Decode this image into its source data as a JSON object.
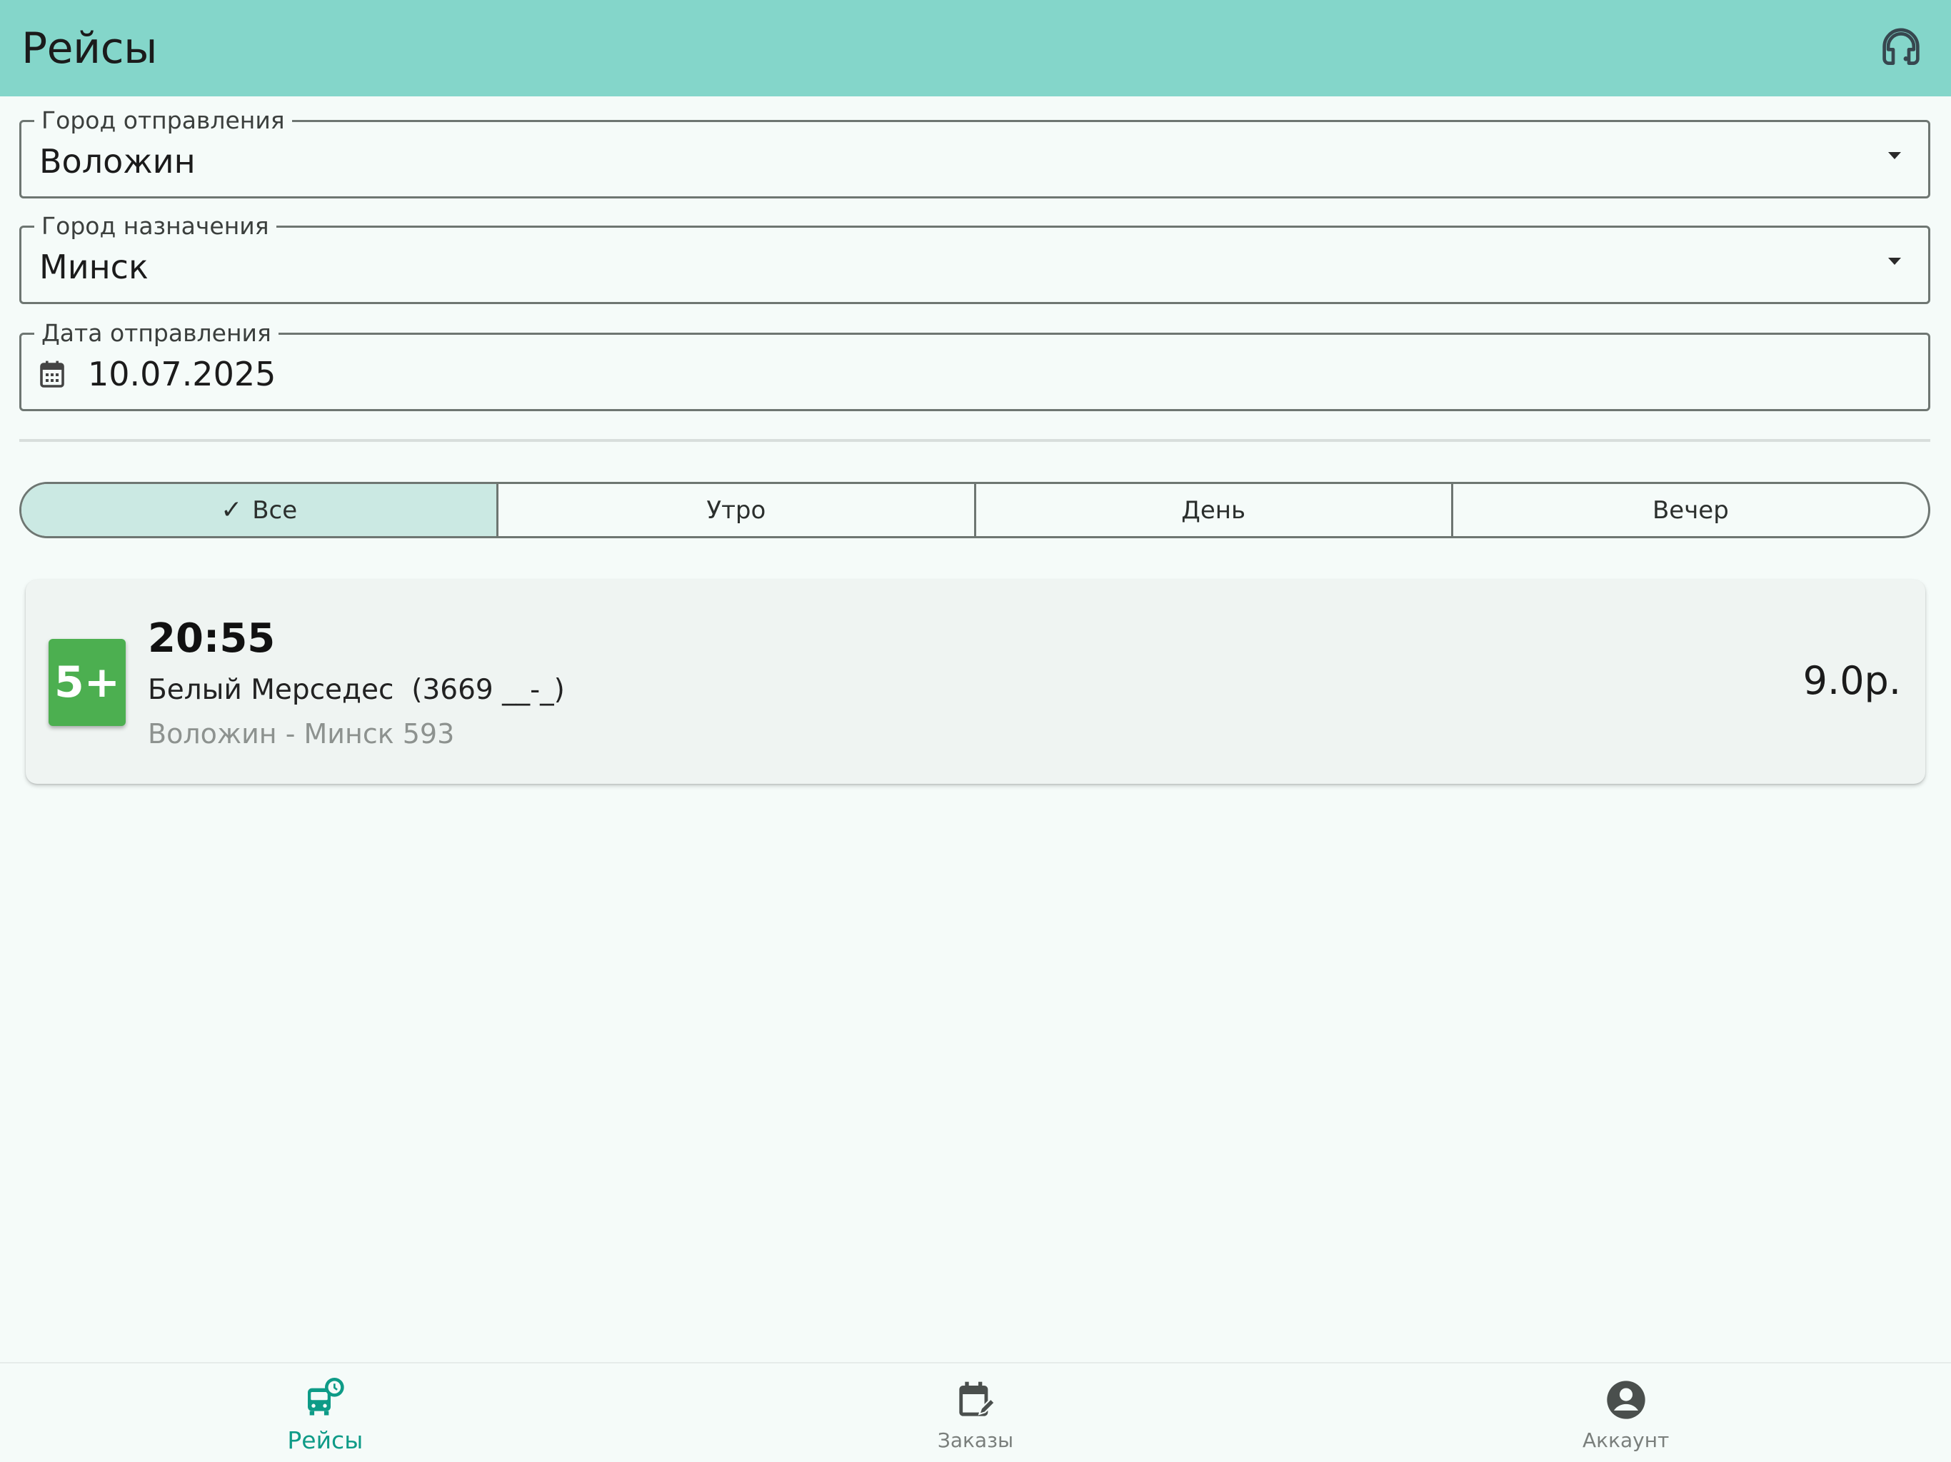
{
  "appbar": {
    "title": "Рейсы",
    "support_icon": "headset-support-icon"
  },
  "form": {
    "departure": {
      "label": "Город отправления",
      "value": "Воложин"
    },
    "destination": {
      "label": "Город назначения",
      "value": "Минск"
    },
    "date": {
      "label": "Дата отправления",
      "value": "10.07.2025",
      "icon": "calendar-icon"
    }
  },
  "time_filter": {
    "options": [
      {
        "label": "Все",
        "selected": true
      },
      {
        "label": "Утро",
        "selected": false
      },
      {
        "label": "День",
        "selected": false
      },
      {
        "label": "Вечер",
        "selected": false
      }
    ]
  },
  "trips": [
    {
      "seats_badge": "5+",
      "time": "20:55",
      "bus": "Белый Мерседес  (3669 __-_)",
      "route": "Воложин - Минск 593",
      "price": "9.0р."
    }
  ],
  "bottom_nav": {
    "items": [
      {
        "label": "Рейсы",
        "icon": "bus-schedule-icon",
        "active": true
      },
      {
        "label": "Заказы",
        "icon": "calendar-edit-icon",
        "active": false
      },
      {
        "label": "Аккаунт",
        "icon": "account-circle-icon",
        "active": false
      }
    ]
  },
  "colors": {
    "appbar": "#84d6ca",
    "background": "#f5fbf9",
    "segment_selected": "#cbe9e3",
    "seats_badge": "#4caf50",
    "nav_active": "#0e9b87"
  }
}
